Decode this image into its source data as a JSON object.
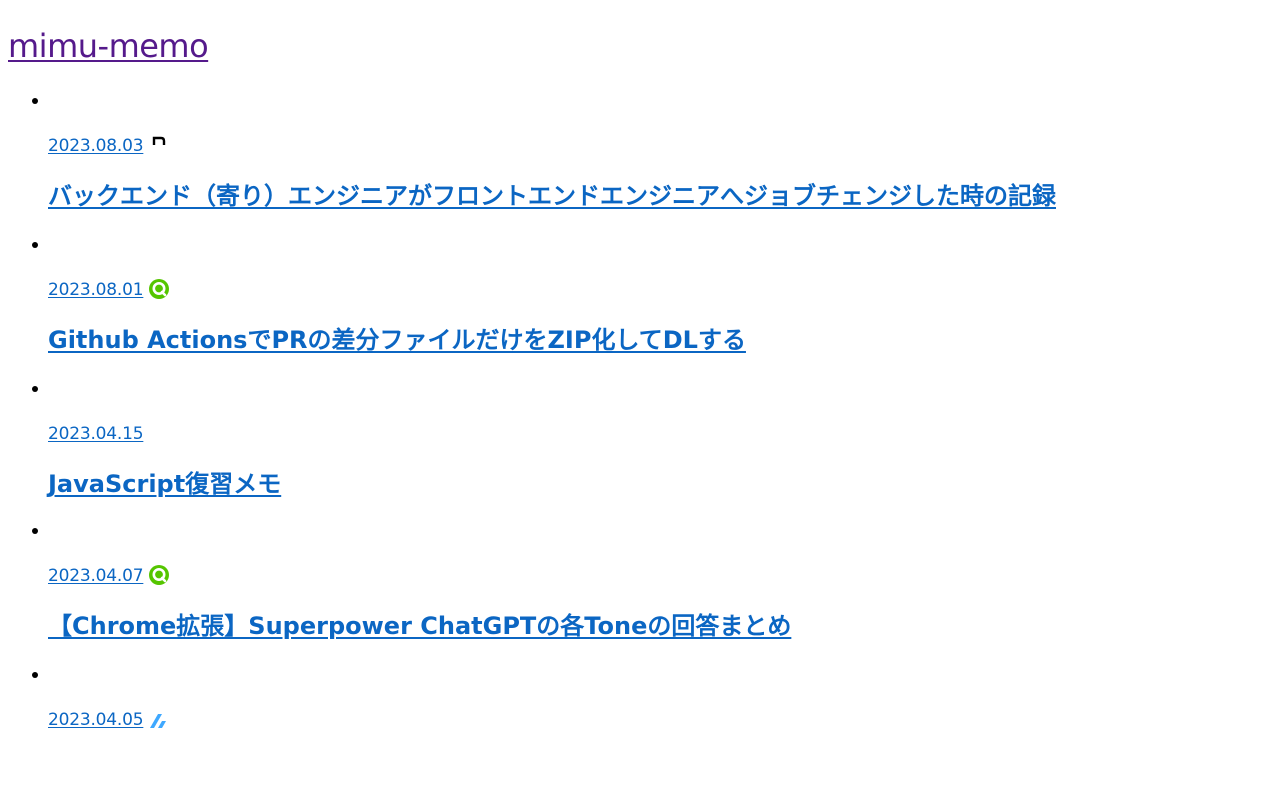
{
  "site": {
    "title": "mimu-memo"
  },
  "posts": [
    {
      "date": "2023.08.03",
      "title": "バックエンド（寄り）エンジニアがフロントエンドエンジニアへジョブチェンジした時の記録",
      "source_icon": "note-icon"
    },
    {
      "date": "2023.08.01",
      "title": "Github ActionsでPRの差分ファイルだけをZIP化してDLする",
      "source_icon": "qiita-icon"
    },
    {
      "date": "2023.04.15",
      "title": "JavaScript復習メモ",
      "source_icon": ""
    },
    {
      "date": "2023.04.07",
      "title": "【Chrome拡張】Superpower ChatGPTの各Toneの回答まとめ",
      "source_icon": "qiita-icon"
    },
    {
      "date": "2023.04.05",
      "title": "",
      "source_icon": "zenn-icon"
    }
  ],
  "colors": {
    "link": "#0b66c3",
    "visited_link": "#551a8b",
    "qiita_green": "#55c500",
    "zenn_blue": "#3ea8ff"
  }
}
